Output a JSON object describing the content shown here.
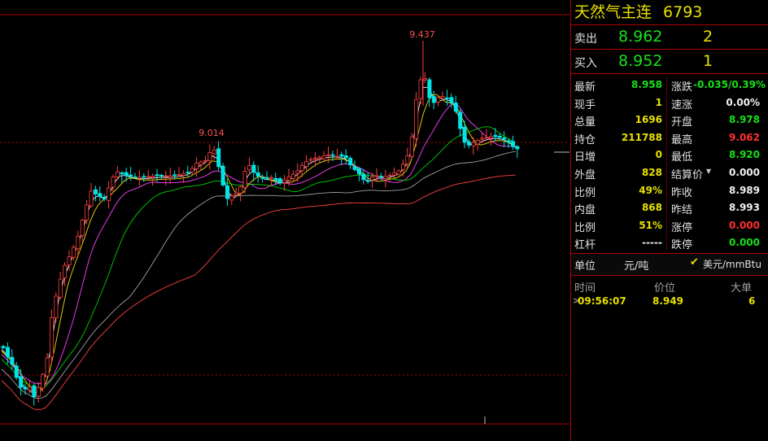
{
  "chart": {
    "high_label": "9.437",
    "local_high_label": "9.014",
    "colors": {
      "up": "#ff4040",
      "down": "#00e6e6",
      "ma1": "#f0f0f0",
      "ma2": "#f0e000",
      "ma3": "#ff40ff",
      "ma4": "#00d000",
      "ma5": "#a0a0a0",
      "ma6": "#ff4040"
    }
  },
  "panel": {
    "instrument": "天然气主连",
    "code": "6793",
    "sell": {
      "label": "卖出",
      "price": "8.962",
      "volume": "2"
    },
    "buy": {
      "label": "买入",
      "price": "8.952",
      "volume": "1"
    },
    "stats": [
      {
        "l": "最新",
        "v": "8.958",
        "c": "g",
        "l2": "涨跌",
        "v2": "-0.035/0.39%",
        "c2": "g"
      },
      {
        "l": "现手",
        "v": "1",
        "c": "y",
        "l2": "速涨",
        "v2": "0.00%",
        "c2": "w"
      },
      {
        "l": "总量",
        "v": "1696",
        "c": "y",
        "l2": "开盘",
        "v2": "8.978",
        "c2": "g"
      },
      {
        "l": "持仓",
        "v": "211788",
        "c": "y",
        "l2": "最高",
        "v2": "9.062",
        "c2": "r"
      },
      {
        "l": "日增",
        "v": "0",
        "c": "y",
        "l2": "最低",
        "v2": "8.920",
        "c2": "g"
      },
      {
        "l": "外盘",
        "v": "828",
        "c": "y",
        "l2": "结算价",
        "v2": "0.000",
        "c2": "w"
      },
      {
        "l": "比例",
        "v": "49%",
        "c": "y",
        "l2": "昨收",
        "v2": "8.989",
        "c2": "w"
      },
      {
        "l": "内盘",
        "v": "868",
        "c": "y",
        "l2": "昨结",
        "v2": "8.993",
        "c2": "w"
      },
      {
        "l": "比例",
        "v": "51%",
        "c": "y",
        "l2": "涨停",
        "v2": "0.000",
        "c2": "r"
      },
      {
        "l": "杠杆",
        "v": "-----",
        "c": "w",
        "l2": "跌停",
        "v2": "0.000",
        "c2": "g"
      }
    ],
    "unit": {
      "label": "单位",
      "value": "元/吨",
      "alt": "美元/mmBtu",
      "check": "✔"
    },
    "ticks_header": {
      "time": "时间",
      "price": "价位",
      "big": "大单"
    },
    "ticks": [
      {
        "time": "09:56:07",
        "price": "8.949",
        "big": "6"
      }
    ]
  }
}
